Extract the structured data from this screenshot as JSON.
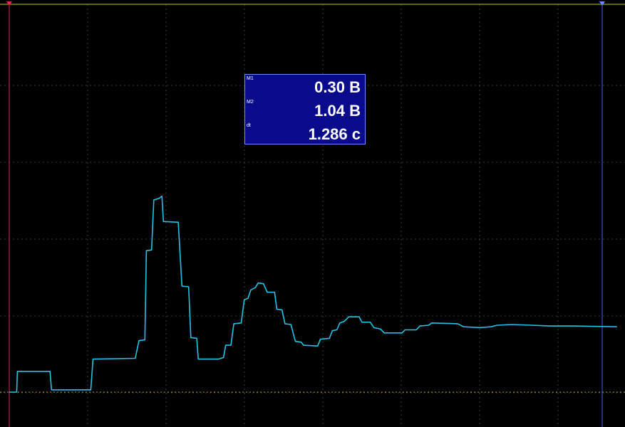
{
  "colors": {
    "background": "#000000",
    "grid": "#3a3a3a",
    "trace": "#22c4e6",
    "cursor_m1": "#e0245e",
    "cursor_m2": "#4d5cff",
    "top_line": "#c8c800",
    "baseline_dotted": "#b0a030",
    "readout_bg": "#0a0a8c"
  },
  "icons": {
    "cursor_m1_marker": "triangle-down-marker-icon",
    "cursor_m2_marker": "triangle-down-marker-icon"
  },
  "readout": {
    "rows": [
      {
        "tag": "M1",
        "value": "0.30 В"
      },
      {
        "tag": "M2",
        "value": "1.04 В"
      },
      {
        "tag": "dt",
        "value": "1.286 с"
      }
    ]
  },
  "chart_data": {
    "type": "line",
    "grid": "on",
    "grid_divisions": {
      "x": 8,
      "y": 5.5
    },
    "series": [
      {
        "values": [
          [
            0.0,
            0.0
          ],
          [
            0.1,
            0.0
          ],
          [
            0.11,
            0.27
          ],
          [
            0.55,
            0.27
          ],
          [
            0.57,
            0.03
          ],
          [
            1.1,
            0.03
          ],
          [
            1.13,
            0.43
          ],
          [
            1.7,
            0.44
          ],
          [
            1.75,
            0.67
          ],
          [
            1.83,
            0.68
          ],
          [
            1.85,
            1.84
          ],
          [
            1.92,
            1.85
          ],
          [
            1.95,
            2.5
          ],
          [
            2.02,
            2.52
          ],
          [
            2.06,
            2.55
          ],
          [
            2.08,
            2.22
          ],
          [
            2.28,
            2.21
          ],
          [
            2.33,
            1.38
          ],
          [
            2.42,
            1.37
          ],
          [
            2.45,
            0.71
          ],
          [
            2.53,
            0.7
          ],
          [
            2.55,
            0.43
          ],
          [
            2.82,
            0.43
          ],
          [
            2.89,
            0.45
          ],
          [
            2.92,
            0.61
          ],
          [
            2.99,
            0.61
          ],
          [
            3.03,
            0.89
          ],
          [
            3.13,
            0.9
          ],
          [
            3.17,
            1.2
          ],
          [
            3.22,
            1.22
          ],
          [
            3.26,
            1.33
          ],
          [
            3.32,
            1.36
          ],
          [
            3.36,
            1.42
          ],
          [
            3.43,
            1.41
          ],
          [
            3.48,
            1.3
          ],
          [
            3.58,
            1.3
          ],
          [
            3.61,
            1.08
          ],
          [
            3.68,
            1.07
          ],
          [
            3.72,
            0.89
          ],
          [
            3.8,
            0.88
          ],
          [
            3.86,
            0.66
          ],
          [
            3.94,
            0.65
          ],
          [
            3.97,
            0.61
          ],
          [
            4.16,
            0.6
          ],
          [
            4.2,
            0.69
          ],
          [
            4.32,
            0.7
          ],
          [
            4.36,
            0.8
          ],
          [
            4.42,
            0.81
          ],
          [
            4.46,
            0.9
          ],
          [
            4.52,
            0.92
          ],
          [
            4.58,
            0.98
          ],
          [
            4.72,
            0.98
          ],
          [
            4.76,
            0.91
          ],
          [
            4.87,
            0.91
          ],
          [
            4.92,
            0.84
          ],
          [
            5.01,
            0.82
          ],
          [
            5.06,
            0.77
          ],
          [
            5.3,
            0.77
          ],
          [
            5.34,
            0.81
          ],
          [
            5.49,
            0.81
          ],
          [
            5.54,
            0.86
          ],
          [
            5.66,
            0.87
          ],
          [
            5.7,
            0.9
          ],
          [
            6.05,
            0.89
          ],
          [
            6.13,
            0.85
          ],
          [
            6.35,
            0.84
          ],
          [
            6.5,
            0.85
          ],
          [
            6.58,
            0.87
          ],
          [
            6.78,
            0.88
          ],
          [
            7.05,
            0.87
          ],
          [
            7.3,
            0.86
          ],
          [
            7.6,
            0.86
          ],
          [
            8.2,
            0.85
          ]
        ]
      }
    ],
    "cursors": {
      "m1_x": 0.0,
      "m2_x": 7.55,
      "baseline_y": 0.0
    }
  }
}
